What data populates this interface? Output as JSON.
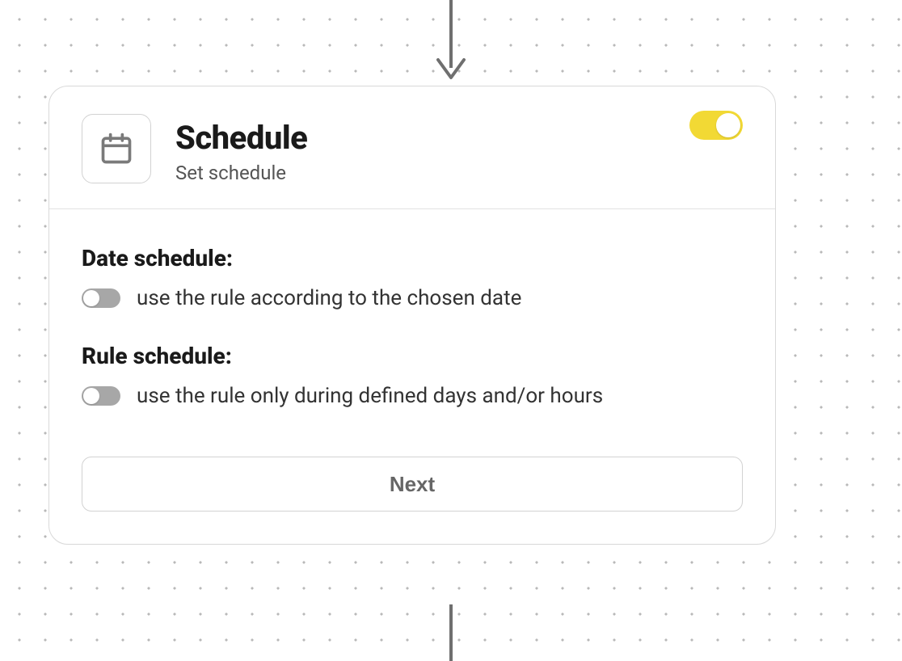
{
  "header": {
    "title": "Schedule",
    "subtitle": "Set schedule",
    "toggle_on": true
  },
  "date_section": {
    "title": "Date schedule:",
    "desc": "use the rule according to the chosen date",
    "toggle_on": false
  },
  "rule_section": {
    "title": "Rule schedule:",
    "desc": "use the rule only during defined days and/or hours",
    "toggle_on": false
  },
  "next_label": "Next"
}
